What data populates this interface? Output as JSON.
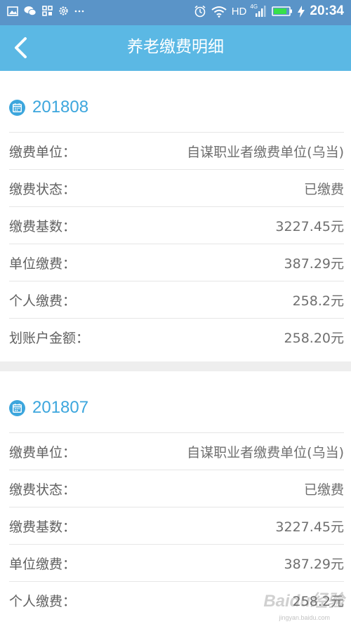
{
  "status_bar": {
    "time": "20:34",
    "network": "HD",
    "network_sub": "4G"
  },
  "header": {
    "title": "养老缴费明细"
  },
  "records": [
    {
      "period": "201808",
      "rows": [
        {
          "label": "缴费单位：",
          "value": "自谋职业者缴费单位(乌当)"
        },
        {
          "label": "缴费状态：",
          "value": "已缴费"
        },
        {
          "label": "缴费基数：",
          "value": "3227.45元"
        },
        {
          "label": "单位缴费：",
          "value": "387.29元"
        },
        {
          "label": "个人缴费：",
          "value": "258.2元"
        },
        {
          "label": "划账户金额：",
          "value": "258.20元"
        }
      ]
    },
    {
      "period": "201807",
      "rows": [
        {
          "label": "缴费单位：",
          "value": "自谋职业者缴费单位(乌当)"
        },
        {
          "label": "缴费状态：",
          "value": "已缴费"
        },
        {
          "label": "缴费基数：",
          "value": "3227.45元"
        },
        {
          "label": "单位缴费：",
          "value": "387.29元"
        },
        {
          "label": "个人缴费：",
          "value": "258.2元"
        }
      ]
    }
  ],
  "watermark": {
    "text": "Baidu经验",
    "sub": "jingyan.baidu.com"
  },
  "colors": {
    "status_bar": "#5a94c8",
    "header": "#5bb8e4",
    "accent": "#3ca6dd",
    "divider": "#e6e6e6",
    "section_gap": "#eeeeee"
  }
}
